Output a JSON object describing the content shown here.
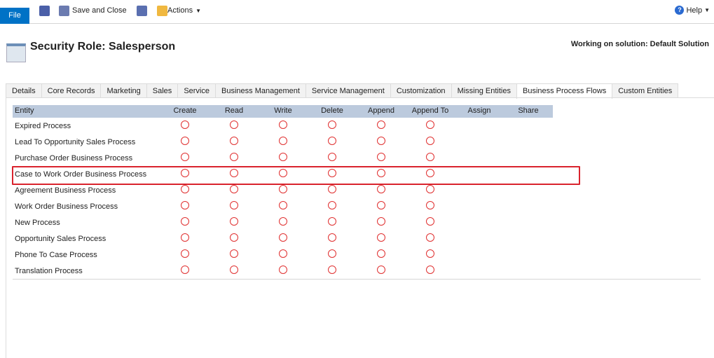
{
  "toolbar": {
    "file": "File",
    "save_and_close": "Save and Close",
    "actions": "Actions",
    "help": "Help"
  },
  "header": {
    "title": "Security Role: Salesperson",
    "solution": "Working on solution: Default Solution"
  },
  "tabs": [
    {
      "label": "Details"
    },
    {
      "label": "Core Records"
    },
    {
      "label": "Marketing"
    },
    {
      "label": "Sales"
    },
    {
      "label": "Service"
    },
    {
      "label": "Business Management"
    },
    {
      "label": "Service Management"
    },
    {
      "label": "Customization"
    },
    {
      "label": "Missing Entities"
    },
    {
      "label": "Business Process Flows",
      "active": true
    },
    {
      "label": "Custom Entities"
    }
  ],
  "table": {
    "columns": [
      "Entity",
      "Create",
      "Read",
      "Write",
      "Delete",
      "Append",
      "Append To",
      "Assign",
      "Share"
    ],
    "privilege_columns_with_indicator": 6,
    "rows": [
      "Expired Process",
      "Lead To Opportunity Sales Process",
      "Purchase Order Business Process",
      "Case to Work Order Business Process",
      "Agreement Business Process",
      "Work Order Business Process",
      "New Process",
      "Opportunity Sales Process",
      "Phone To Case Process",
      "Translation Process"
    ],
    "highlighted_row": 3,
    "indicator_color": "#e03030",
    "highlight_color": "#d9232d"
  }
}
